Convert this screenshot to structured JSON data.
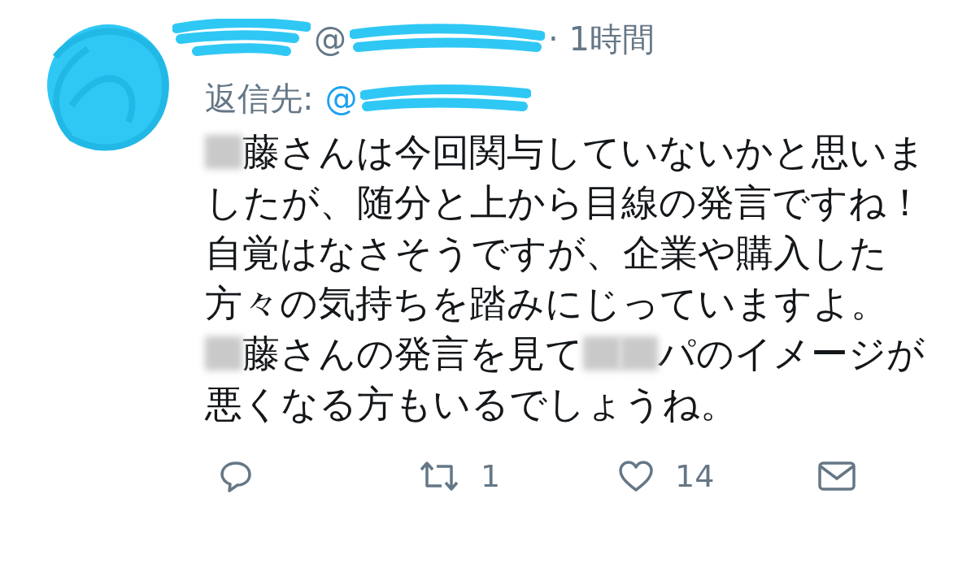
{
  "tweet": {
    "handle": "@",
    "time": "· 1時間",
    "reply_label": "返信先:",
    "reply_to": "@",
    "body": [
      {
        "segments": [
          {
            "kind": "redacted"
          },
          {
            "kind": "text",
            "text": "藤さんは今回関与していないかと思いましたが、随分と上から目線の発言ですね！"
          }
        ]
      },
      {
        "segments": [
          {
            "kind": "text",
            "text": "自覚はなさそうですが、企業や購入した方々の気持ちを踏みにじっていますよ。"
          }
        ]
      },
      {
        "segments": [
          {
            "kind": "redacted"
          },
          {
            "kind": "text",
            "text": "藤さんの発言を見て"
          },
          {
            "kind": "redacted"
          },
          {
            "kind": "redacted"
          },
          {
            "kind": "text",
            "text": "パのイメージが悪くなる方もいるでしょうね。"
          }
        ]
      }
    ],
    "actions": [
      {
        "kind": "reply"
      },
      {
        "kind": "retweet",
        "count": "1"
      },
      {
        "kind": "like",
        "count": "14"
      },
      {
        "kind": "message"
      }
    ]
  }
}
